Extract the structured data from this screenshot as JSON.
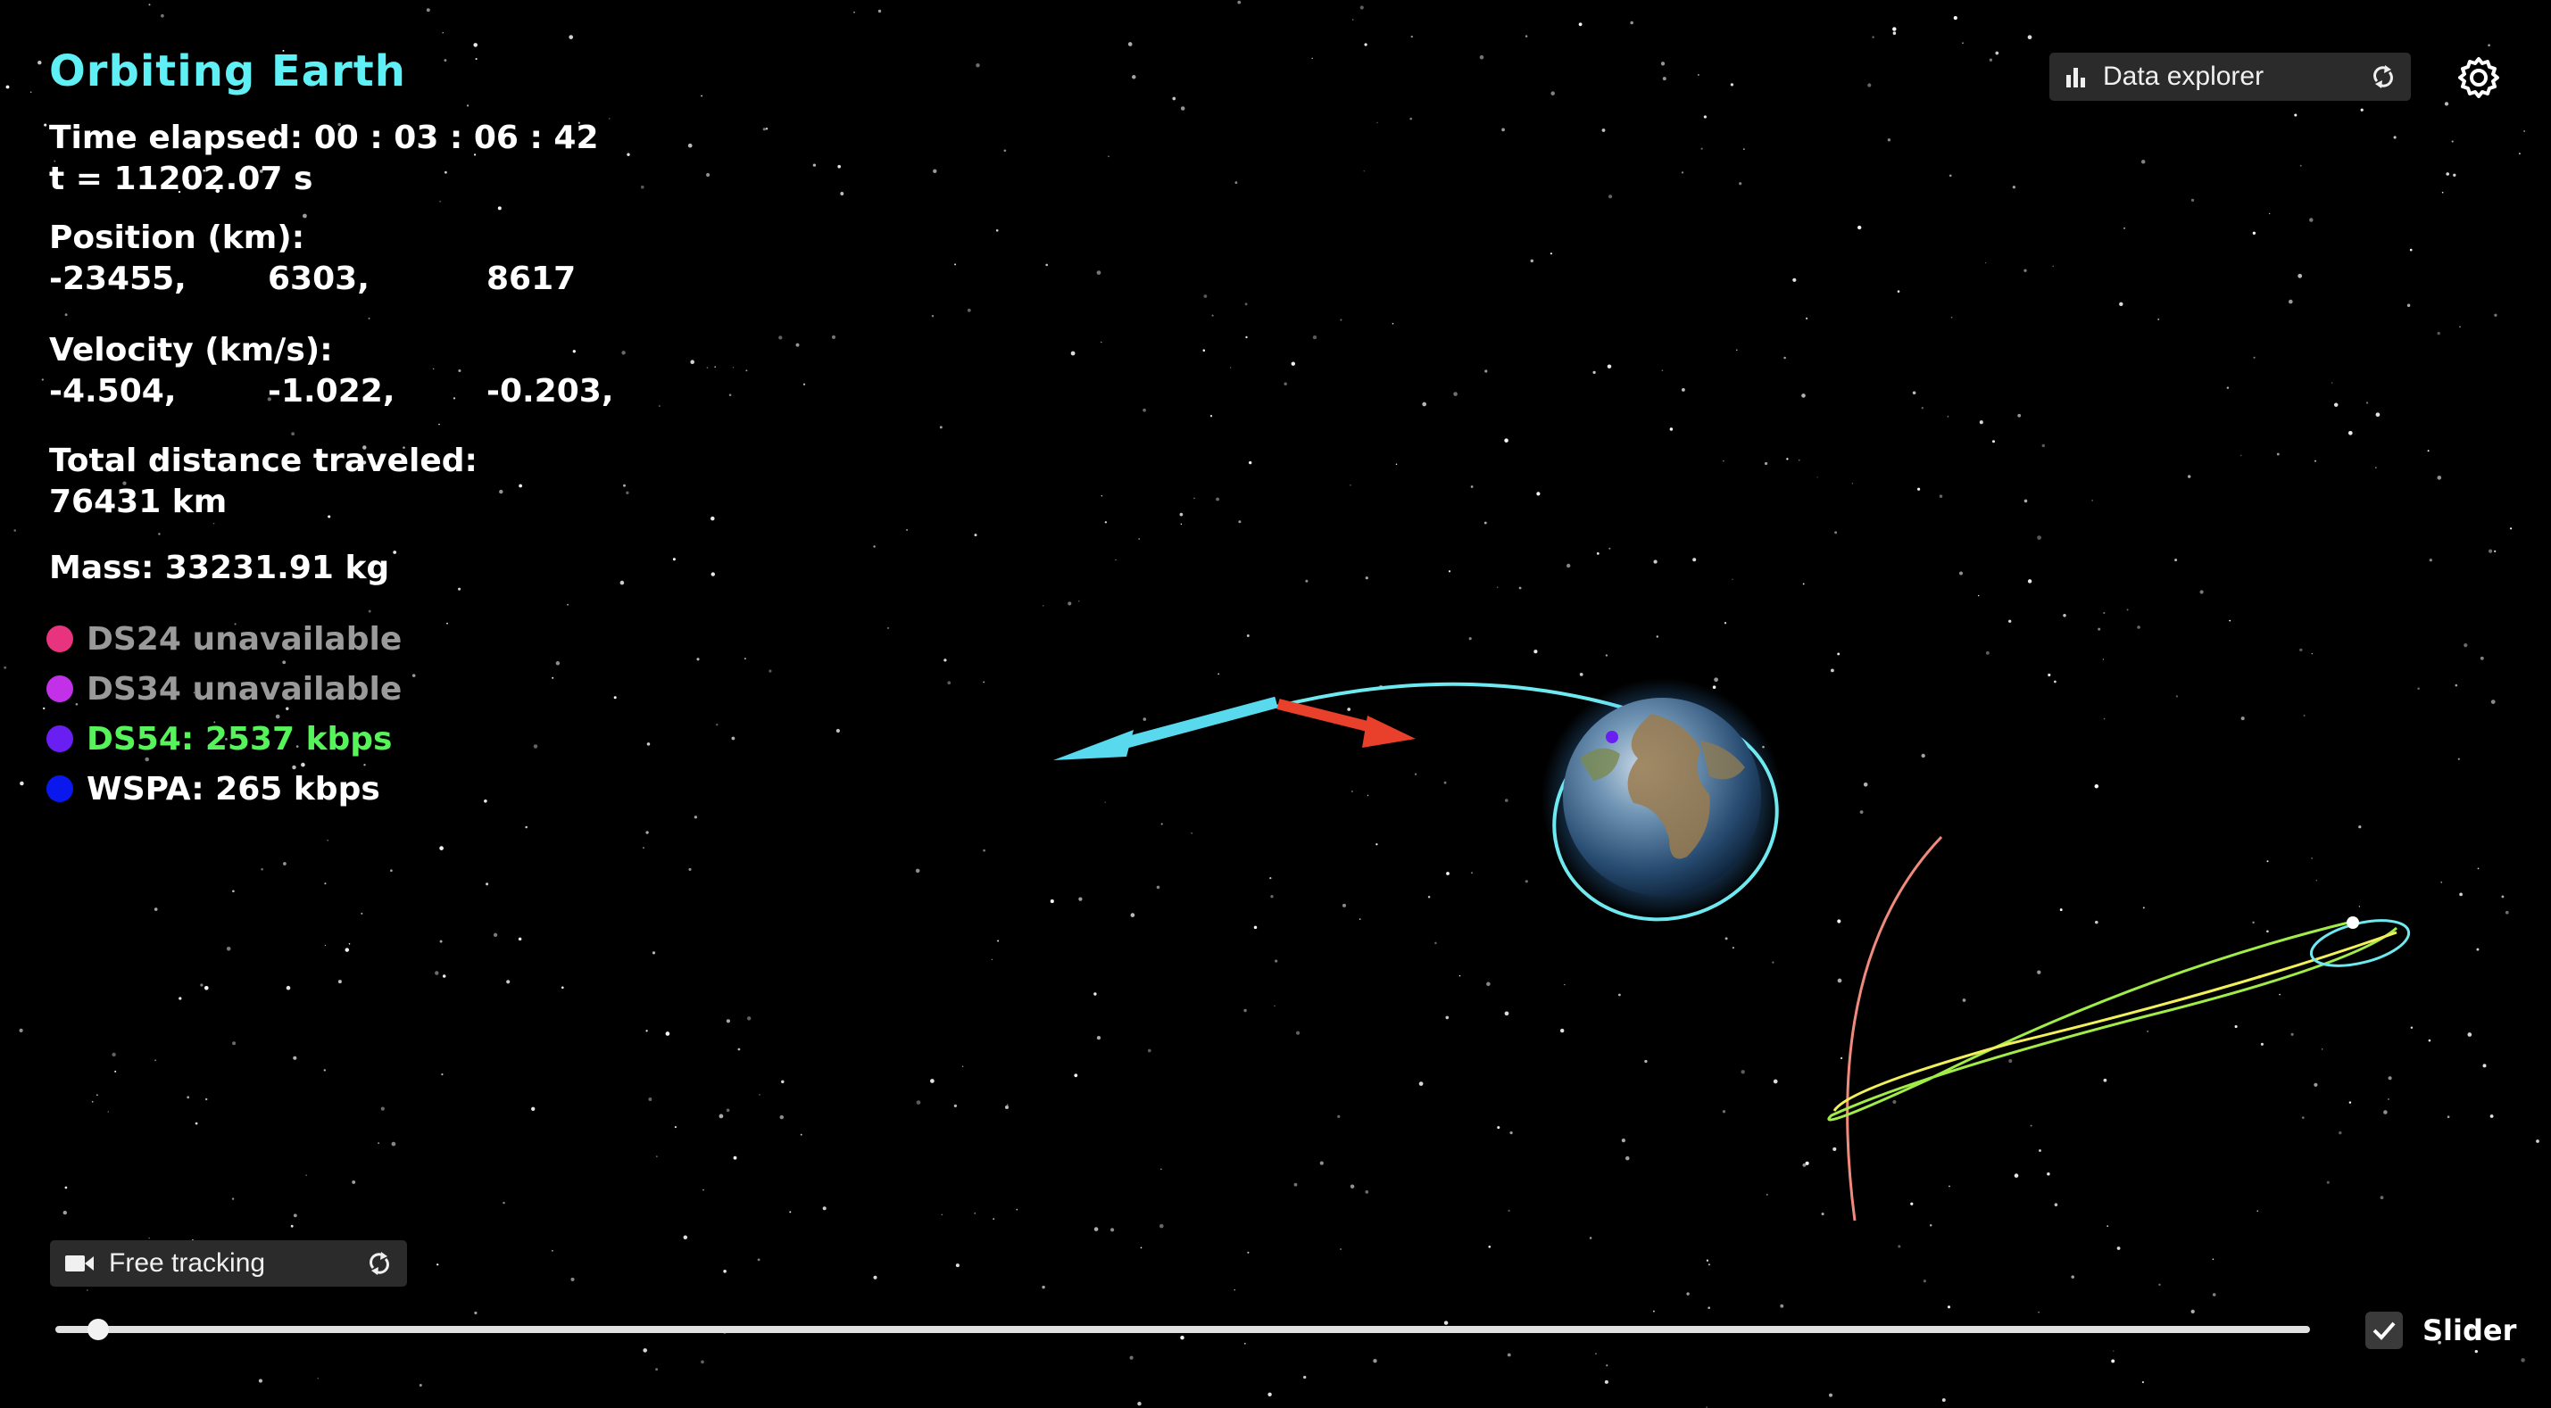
{
  "title": "Orbiting Earth",
  "time": {
    "elapsed": "Time elapsed: 00 : 03 : 06 : 42",
    "t": "t = 11202.07 s"
  },
  "position": {
    "label": "Position (km):",
    "values": [
      "-23455,",
      "6303,",
      "8617"
    ]
  },
  "velocity": {
    "label": "Velocity (km/s):",
    "values": [
      "-4.504,",
      "-1.022,",
      "-0.203,"
    ]
  },
  "distance": {
    "label": "Total distance traveled:",
    "value": "76431 km"
  },
  "mass": "Mass: 33231.91 kg",
  "stations": [
    {
      "text": "DS24 unavailable",
      "color": "#e8337f",
      "status": "off"
    },
    {
      "text": "DS34 unavailable",
      "color": "#c231e8",
      "status": "off"
    },
    {
      "text": "DS54: 2537 kbps",
      "color": "#6a1ff2",
      "status": "good"
    },
    {
      "text": "WSPA: 265 kbps",
      "color": "#0a18ee",
      "status": "norm"
    }
  ],
  "data_explorer": {
    "label": "Data explorer",
    "icon": "bar-chart-icon",
    "cycle_icon": "cycle-icon"
  },
  "settings": {
    "icon": "gear-icon"
  },
  "camera": {
    "label": "Free tracking",
    "icon": "video-camera-icon",
    "cycle_icon": "cycle-icon"
  },
  "slider": {
    "label": "Slider",
    "checked": true,
    "value_fraction": 0.019
  },
  "colors": {
    "title": "#5ff0f6",
    "orbit": "#6fe9f0",
    "velocity_arrow": "#58d9ee",
    "thrust_arrow": "#e8402a",
    "station_good": "#57f35a"
  }
}
